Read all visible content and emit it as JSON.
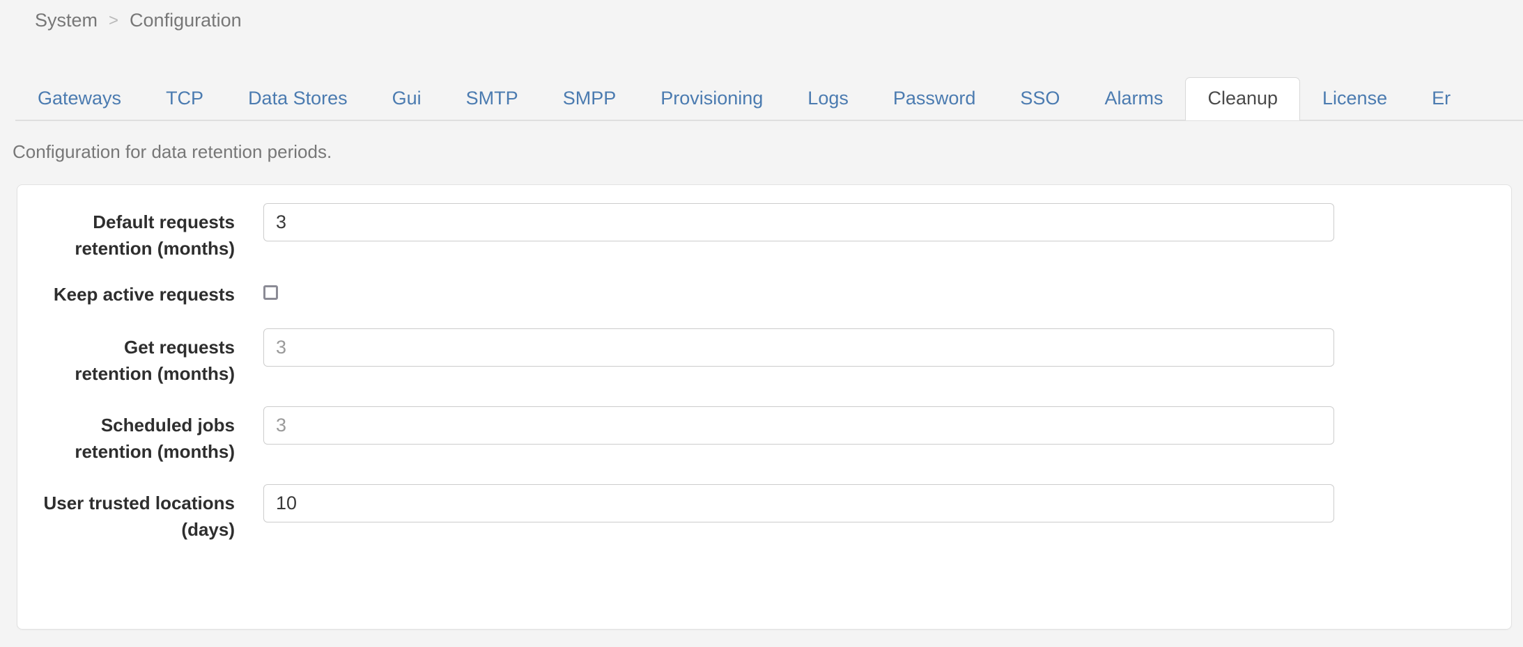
{
  "breadcrumb": {
    "items": [
      "System",
      "Configuration"
    ],
    "separator": ">"
  },
  "tabs": {
    "items": [
      {
        "label": "Gateways",
        "active": false
      },
      {
        "label": "TCP",
        "active": false
      },
      {
        "label": "Data Stores",
        "active": false
      },
      {
        "label": "Gui",
        "active": false
      },
      {
        "label": "SMTP",
        "active": false
      },
      {
        "label": "SMPP",
        "active": false
      },
      {
        "label": "Provisioning",
        "active": false
      },
      {
        "label": "Logs",
        "active": false
      },
      {
        "label": "Password",
        "active": false
      },
      {
        "label": "SSO",
        "active": false
      },
      {
        "label": "Alarms",
        "active": false
      },
      {
        "label": "Cleanup",
        "active": true
      },
      {
        "label": "License",
        "active": false
      },
      {
        "label": "Er",
        "active": false
      }
    ]
  },
  "page": {
    "description": "Configuration for data retention periods."
  },
  "form": {
    "fields": [
      {
        "label_line1": "Default requests",
        "label_line2": "retention (months)",
        "type": "text",
        "value": "3",
        "placeholder": ""
      },
      {
        "label_line1": "Keep active requests",
        "label_line2": "",
        "type": "checkbox",
        "checked": false
      },
      {
        "label_line1": "Get requests",
        "label_line2": "retention (months)",
        "type": "text",
        "value": "",
        "placeholder": "3"
      },
      {
        "label_line1": "Scheduled jobs",
        "label_line2": "retention (months)",
        "type": "text",
        "value": "",
        "placeholder": "3"
      },
      {
        "label_line1": "User trusted locations",
        "label_line2": "(days)",
        "type": "text",
        "value": "10",
        "placeholder": ""
      }
    ]
  },
  "colors": {
    "page_background": "#f4f4f4",
    "tab_link": "#4b7bb0",
    "active_tab_text": "#4a4a4a",
    "label_text": "#2e2e2e",
    "muted_text": "#777777",
    "placeholder_text": "#9a9a9a",
    "card_background": "#ffffff",
    "border": "#d8d8d8"
  }
}
